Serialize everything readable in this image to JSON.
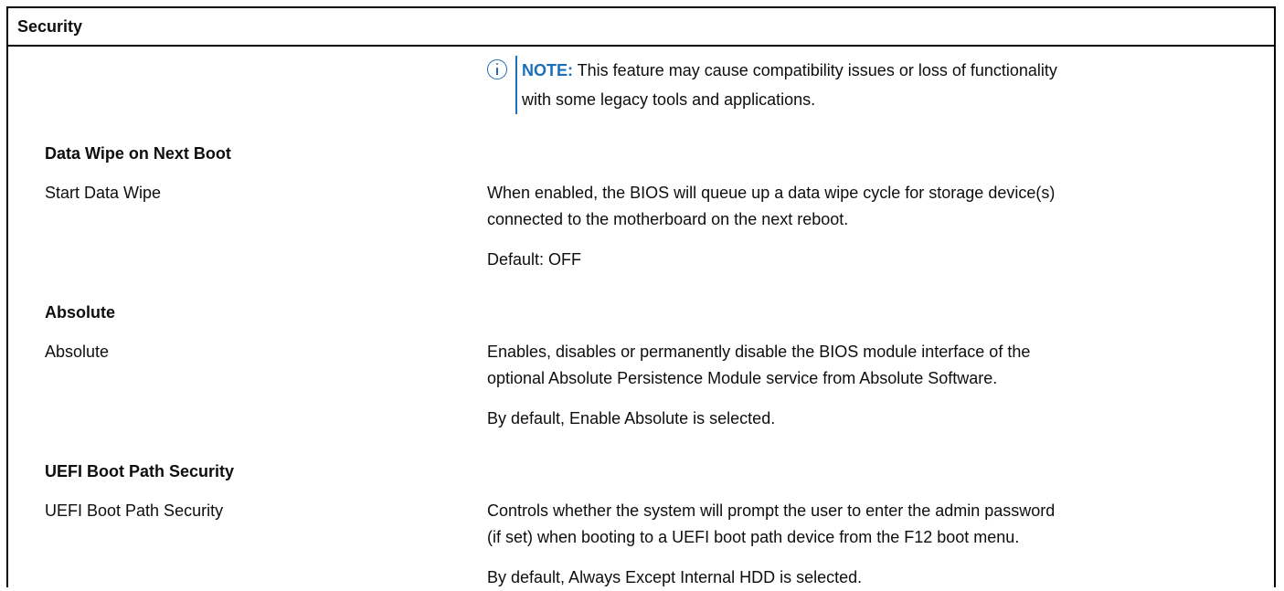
{
  "header": {
    "title": "Security"
  },
  "note": {
    "label": "NOTE:",
    "line1": " This feature may cause compatibility issues or loss of functionality",
    "line2": "with some legacy tools and applications.",
    "icon": "info-icon"
  },
  "sections": [
    {
      "heading": "Data Wipe on Next Boot",
      "option": "Start Data Wipe",
      "description": [
        "When enabled, the BIOS will queue up a data wipe cycle for storage device(s)",
        "connected to the motherboard on the next reboot."
      ],
      "default": "Default: OFF"
    },
    {
      "heading": "Absolute",
      "option": "Absolute",
      "description": [
        "Enables, disables or permanently disable the BIOS module interface of the",
        "optional Absolute Persistence Module service from Absolute Software."
      ],
      "default": "By default, Enable Absolute is selected."
    },
    {
      "heading": "UEFI Boot Path Security",
      "option": "UEFI Boot Path Security",
      "description": [
        "Controls whether the system will prompt the user to enter the admin password",
        "(if set) when booting to a UEFI boot path device from the F12 boot menu."
      ],
      "default": "By default, Always Except Internal HDD is selected."
    }
  ],
  "colors": {
    "accent": "#1d6fb8",
    "text": "#0e0e0e",
    "border": "#000000"
  }
}
